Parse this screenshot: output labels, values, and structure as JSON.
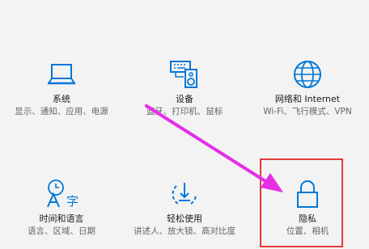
{
  "tiles": [
    {
      "title": "系统",
      "desc": "显示、通知、应用、电源",
      "icon": "laptop-icon"
    },
    {
      "title": "设备",
      "desc": "蓝牙、打印机、鼠标",
      "icon": "devices-icon"
    },
    {
      "title": "网络和 Internet",
      "desc": "Wi-Fi、飞行模式、VPN",
      "icon": "globe-icon"
    },
    {
      "title": "时间和语言",
      "desc": "语言、区域、日期",
      "icon": "time-language-icon"
    },
    {
      "title": "轻松使用",
      "desc": "讲述人、放大镜、高对比度",
      "icon": "ease-of-access-icon"
    },
    {
      "title": "隐私",
      "desc": "位置、相机",
      "icon": "lock-icon"
    }
  ],
  "colors": {
    "accent": "#0078d7",
    "annotation_arrow": "#e62ee6",
    "highlight_box": "#e43a3a"
  }
}
